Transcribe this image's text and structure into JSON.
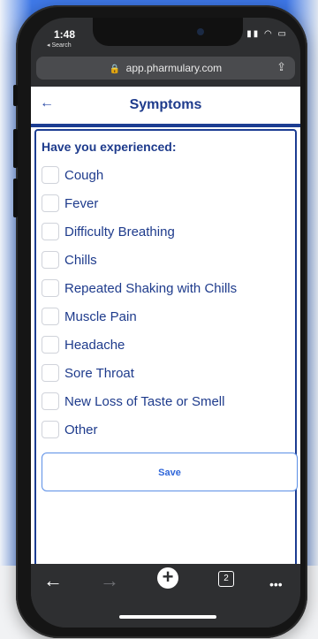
{
  "status_bar": {
    "time": "1:48",
    "back_to": "◂ Search",
    "icons": "📶 ◡ ▭"
  },
  "browser": {
    "url": "app.pharmulary.com",
    "lock_icon": "🔒",
    "share_icon": "⇪"
  },
  "header": {
    "back_icon": "←",
    "title": "Symptoms"
  },
  "form": {
    "question": "Have you experienced:",
    "symptoms": [
      {
        "label": "Cough",
        "checked": false
      },
      {
        "label": "Fever",
        "checked": false
      },
      {
        "label": "Difficulty Breathing",
        "checked": false
      },
      {
        "label": "Chills",
        "checked": false
      },
      {
        "label": "Repeated Shaking with Chills",
        "checked": false
      },
      {
        "label": "Muscle Pain",
        "checked": false
      },
      {
        "label": "Headache",
        "checked": false
      },
      {
        "label": "Sore Throat",
        "checked": false
      },
      {
        "label": "New Loss of Taste or Smell",
        "checked": false
      },
      {
        "label": "Other",
        "checked": false
      }
    ],
    "save_label": "Save"
  },
  "bottom_toolbar": {
    "back_icon": "←",
    "forward_icon": "→",
    "new_tab_icon": "+",
    "tabs_count": "2",
    "more_icon": "•••"
  },
  "colors": {
    "primary": "#1e3b8c",
    "accent": "#2f66d9",
    "background_blue": "#3d76e6"
  }
}
